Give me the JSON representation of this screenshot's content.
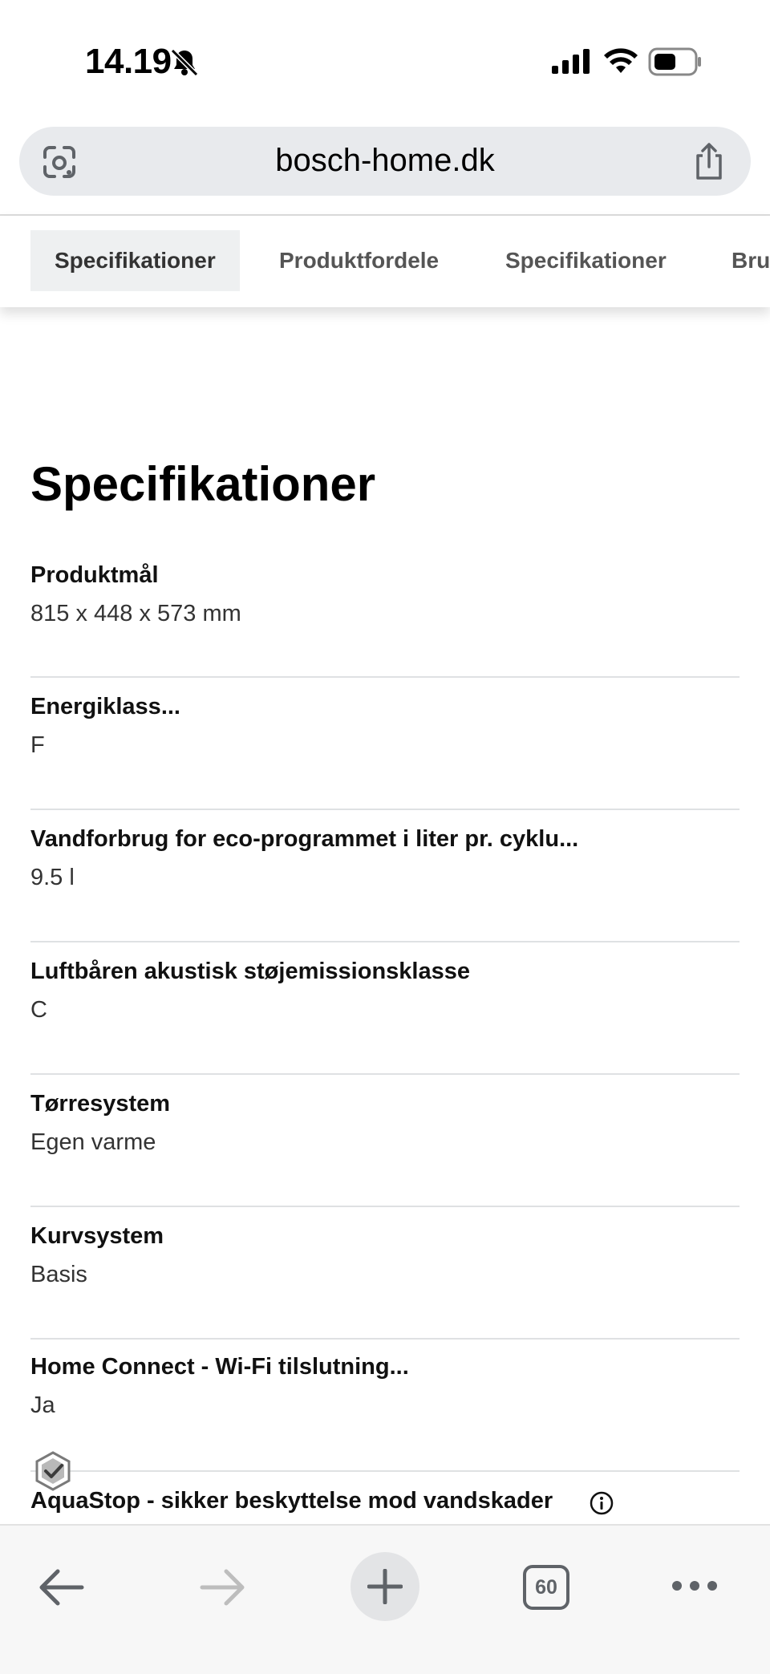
{
  "status_bar": {
    "time": "14.19",
    "silent_icon": "bell-slash-icon",
    "signal_icon": "cellular-signal-icon",
    "wifi_icon": "wifi-icon",
    "battery_icon": "battery-icon"
  },
  "browser": {
    "url": "bosch-home.dk",
    "lens_icon": "google-lens-icon",
    "share_icon": "share-icon"
  },
  "tabs": [
    {
      "label": "Specifikationer",
      "active": true
    },
    {
      "label": "Produktfordele",
      "active": false
    },
    {
      "label": "Specifikationer",
      "active": false
    },
    {
      "label": "Bru",
      "active": false
    }
  ],
  "main": {
    "title": "Specifikationer",
    "specs": [
      {
        "label": "Produktmål",
        "value": "815 x 448 x 573 mm"
      },
      {
        "label": "Energiklass...",
        "value": "F"
      },
      {
        "label": "Vandforbrug for eco-programmet i liter pr. cyklu...",
        "value": "9.5 l"
      },
      {
        "label": "Luftbåren akustisk støjemissionsklasse",
        "value": "C"
      },
      {
        "label": "Tørresystem",
        "value": "Egen varme"
      },
      {
        "label": "Kurvsystem",
        "value": "Basis"
      },
      {
        "label": "Home Connect - Wi-Fi tilslutning...",
        "value": "Ja"
      }
    ],
    "last_spec_label": "AquaStop - sikker beskyttelse mod vandskader"
  },
  "toolbar": {
    "back_icon": "arrow-left-icon",
    "forward_icon": "arrow-right-icon",
    "new_tab_icon": "plus-icon",
    "tab_count": "60",
    "more_icon": "ellipsis-icon"
  }
}
